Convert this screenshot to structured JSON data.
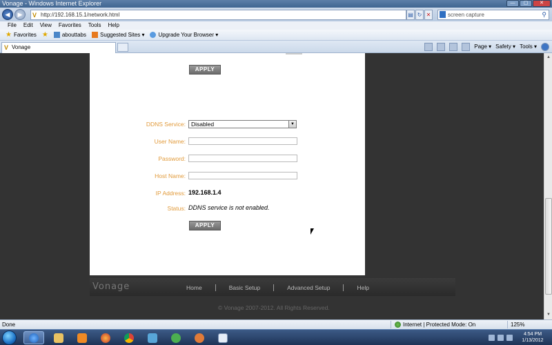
{
  "window": {
    "title": "Vonage - Windows Internet Explorer",
    "buttons": {
      "minimize": "—",
      "maximize": "▢",
      "close": "✕"
    }
  },
  "addressbar": {
    "url": "http://192.168.15.1/network.html",
    "search_placeholder": "screen capture"
  },
  "menubar": {
    "items": [
      "File",
      "Edit",
      "View",
      "Favorites",
      "Tools",
      "Help"
    ]
  },
  "favorites": {
    "label": "Favorites",
    "items": [
      "abouttabs",
      "Suggested Sites ▾",
      "Upgrade Your Browser ▾"
    ]
  },
  "tabs": {
    "active": "Vonage"
  },
  "commandbar": {
    "items": [
      "Page ▾",
      "Safety ▾",
      "Tools ▾"
    ]
  },
  "form": {
    "apply_top": "APPLY",
    "ddns_label": "DDNS Service:",
    "ddns_value": "Disabled",
    "user_label": "User Name:",
    "password_label": "Password:",
    "host_label": "Host Name:",
    "ip_label": "IP Address:",
    "ip_value": "192.168.1.4",
    "status_label": "Status:",
    "status_value": "DDNS service is not enabled.",
    "apply_bottom": "APPLY"
  },
  "footer": {
    "brand": "Vonage",
    "links": [
      "Home",
      "Basic Setup",
      "Advanced Setup",
      "Help"
    ],
    "copyright": "© Vonage 2007-2012. All Rights Reserved."
  },
  "statusbar": {
    "status": "Done",
    "zone": "Internet | Protected Mode: On",
    "zoom": "125%"
  },
  "taskbar": {
    "time": "4:54 PM",
    "date": "1/13/2012"
  },
  "colors": {
    "label_orange": "#e19a3a",
    "page_background": "#333333",
    "panel_background": "#ffffff"
  }
}
